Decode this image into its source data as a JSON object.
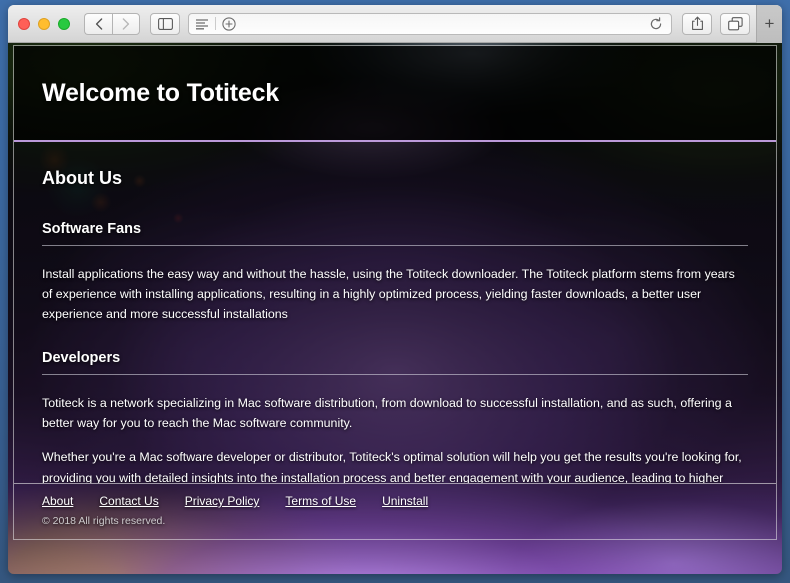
{
  "desktop": {
    "bg_top": "#3f6fab",
    "bg_bottom": "#35577f"
  },
  "browser": {
    "traffic_lights": [
      {
        "name": "close",
        "color": "#ff5f57"
      },
      {
        "name": "minimize",
        "color": "#ffbd2e"
      },
      {
        "name": "zoom",
        "color": "#28c940"
      }
    ],
    "nav": {
      "back": "‹",
      "forward": "›"
    },
    "sidebar_button": "sidebar-icon",
    "address_bar": {
      "value": "",
      "placeholder": "",
      "reader_icon": "reader-icon",
      "zoom_icon": "plus-circle-icon",
      "reload_icon": "reload-icon"
    },
    "right_tools": {
      "share_icon": "share-icon",
      "tabs_icon": "show-tabs-icon"
    },
    "new_tab_label": "+"
  },
  "page": {
    "hero": {
      "title": "Welcome to Totiteck"
    },
    "section": {
      "title": "About Us"
    },
    "blocks": [
      {
        "heading": "Software Fans",
        "paragraphs": [
          "Install applications the easy way and without the hassle, using the Totiteck downloader. The Totiteck platform stems from years of experience with installing applications, resulting in a highly optimized process, yielding faster downloads, a better user experience and more successful installations"
        ]
      },
      {
        "heading": "Developers",
        "paragraphs": [
          "Totiteck is a network specializing in Mac software distribution, from download to successful installation, and as such, offering a better way for you to reach the Mac software community.",
          "Whether you're a Mac software developer or distributor, Totiteck's optimal solution will help you get the results you're looking for, providing you with detailed insights into the installation process and better engagement with your audience, leading to higher revenues."
        ]
      }
    ],
    "footer": {
      "links": [
        {
          "label": "About"
        },
        {
          "label": "Contact Us"
        },
        {
          "label": "Privacy Policy"
        },
        {
          "label": "Terms of Use"
        },
        {
          "label": "Uninstall"
        }
      ],
      "copyright": "© 2018 All rights reserved."
    },
    "colors": {
      "accent_rule": "#dcb4ff",
      "text": "#ffffff"
    }
  }
}
